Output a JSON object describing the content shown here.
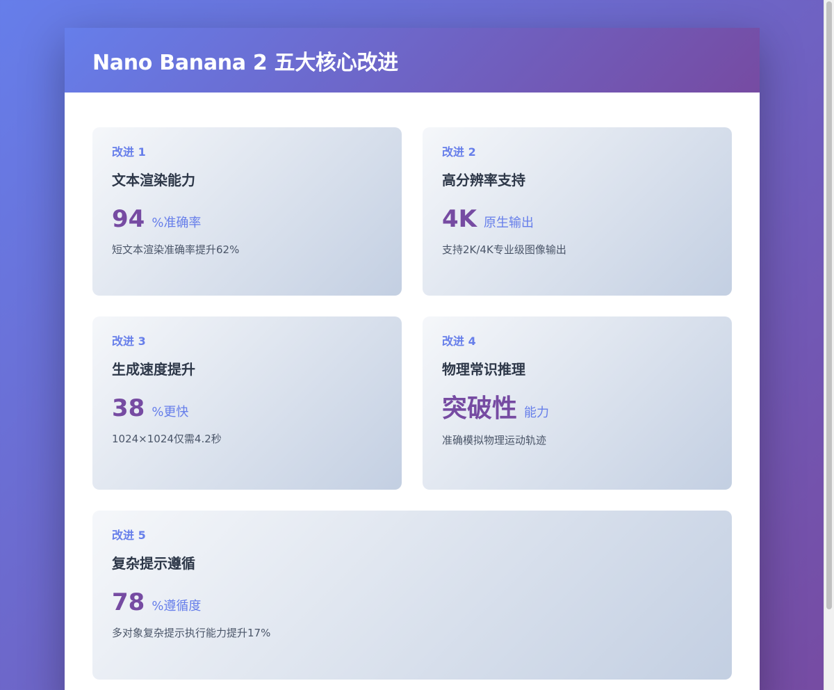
{
  "header": {
    "title": "Nano Banana 2 五大核心改进"
  },
  "improvements": [
    {
      "label": "改进 1",
      "title": "文本渲染能力",
      "value": "94",
      "unit": "%准确率",
      "desc": "短文本渲染准确率提升62%"
    },
    {
      "label": "改进 2",
      "title": "高分辨率支持",
      "value": "4K",
      "unit": "原生输出",
      "desc": "支持2K/4K专业级图像输出"
    },
    {
      "label": "改进 3",
      "title": "生成速度提升",
      "value": "38",
      "unit": "%更快",
      "desc": "1024×1024仅需4.2秒"
    },
    {
      "label": "改进 4",
      "title": "物理常识推理",
      "value": "突破性",
      "unit": "能力",
      "desc": "准确模拟物理运动轨迹"
    },
    {
      "label": "改进 5",
      "title": "复杂提示遵循",
      "value": "78",
      "unit": "%遵循度",
      "desc": "多对象复杂提示执行能力提升17%"
    }
  ],
  "colors": {
    "gradient_start": "#667eea",
    "gradient_end": "#764ba2",
    "title_text": "#2d3748",
    "desc_text": "#4a5568"
  }
}
